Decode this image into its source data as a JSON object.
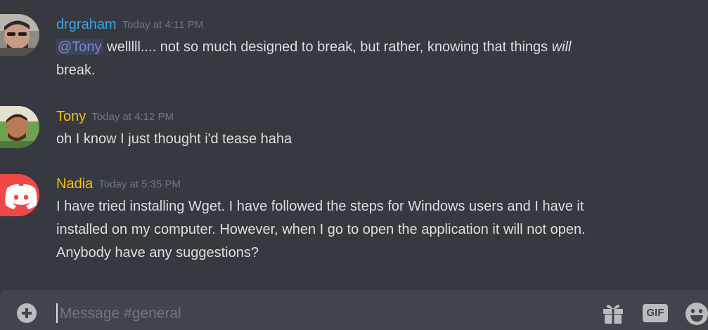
{
  "colors": {
    "background": "#36393f",
    "composer": "#40444b",
    "name_blue": "#3ba7e6",
    "name_yellow": "#f1c40f",
    "mention": "#7289da",
    "discord_red": "#f04747"
  },
  "messages": [
    {
      "author": "drgraham",
      "timestamp": "Today at 4:11 PM",
      "avatar_icon": "user-photo-avatar",
      "mention": "@Tony",
      "line1_text": " welllll.... not so much designed to break, but rather, knowing that things ",
      "line1_italic": "will",
      "line2": "break."
    },
    {
      "author": "Tony",
      "timestamp": "Today at 4:12 PM",
      "avatar_icon": "user-photo-avatar",
      "line1": "oh I know I just thought i'd tease haha"
    },
    {
      "author": "Nadia",
      "timestamp": "Today at 5:35 PM",
      "avatar_icon": "discord-logo-avatar",
      "line1": "I have tried installing Wget. I have followed the steps for Windows users and I have it",
      "line2": "installed on my computer. However, when I go to open the application it will not open.",
      "line3": "Anybody have any suggestions?"
    }
  ],
  "composer": {
    "placeholder": "Message #general",
    "attach_icon": "plus-circle-icon",
    "gift_icon": "gift-icon",
    "gif_label": "GIF",
    "emoji_icon": "smiley-emoji-icon"
  }
}
